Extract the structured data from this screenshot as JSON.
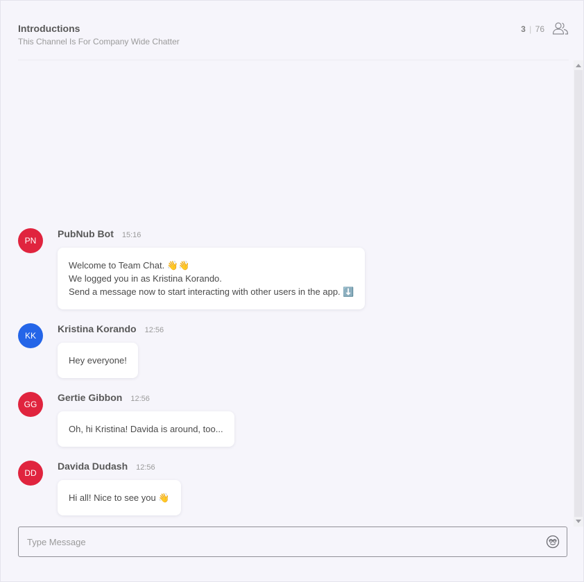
{
  "channel": {
    "title": "Introductions",
    "description": "This Channel Is For Company Wide Chatter",
    "online_count": "3",
    "separator": "|",
    "total_count": "76"
  },
  "messages": [
    {
      "initials": "PN",
      "sender": "PubNub Bot",
      "time": "15:16",
      "avatar_color": "#e0243e",
      "lines": [
        "Welcome to Team Chat. 👋👋",
        "We logged you in as Kristina Korando.",
        "Send a message now to start interacting with other users in the app. ⬇️"
      ]
    },
    {
      "initials": "KK",
      "sender": "Kristina Korando",
      "time": "12:56",
      "avatar_color": "#2465e8",
      "lines": [
        "Hey everyone!"
      ]
    },
    {
      "initials": "GG",
      "sender": "Gertie Gibbon",
      "time": "12:56",
      "avatar_color": "#e0243e",
      "lines": [
        "Oh, hi Kristina! Davida is around, too..."
      ]
    },
    {
      "initials": "DD",
      "sender": "Davida Dudash",
      "time": "12:56",
      "avatar_color": "#e0243e",
      "lines": [
        "Hi all! Nice to see you 👋"
      ]
    }
  ],
  "composer": {
    "placeholder": "Type Message"
  },
  "icons": {
    "members": "members-icon",
    "emoji": "emoji-icon"
  }
}
